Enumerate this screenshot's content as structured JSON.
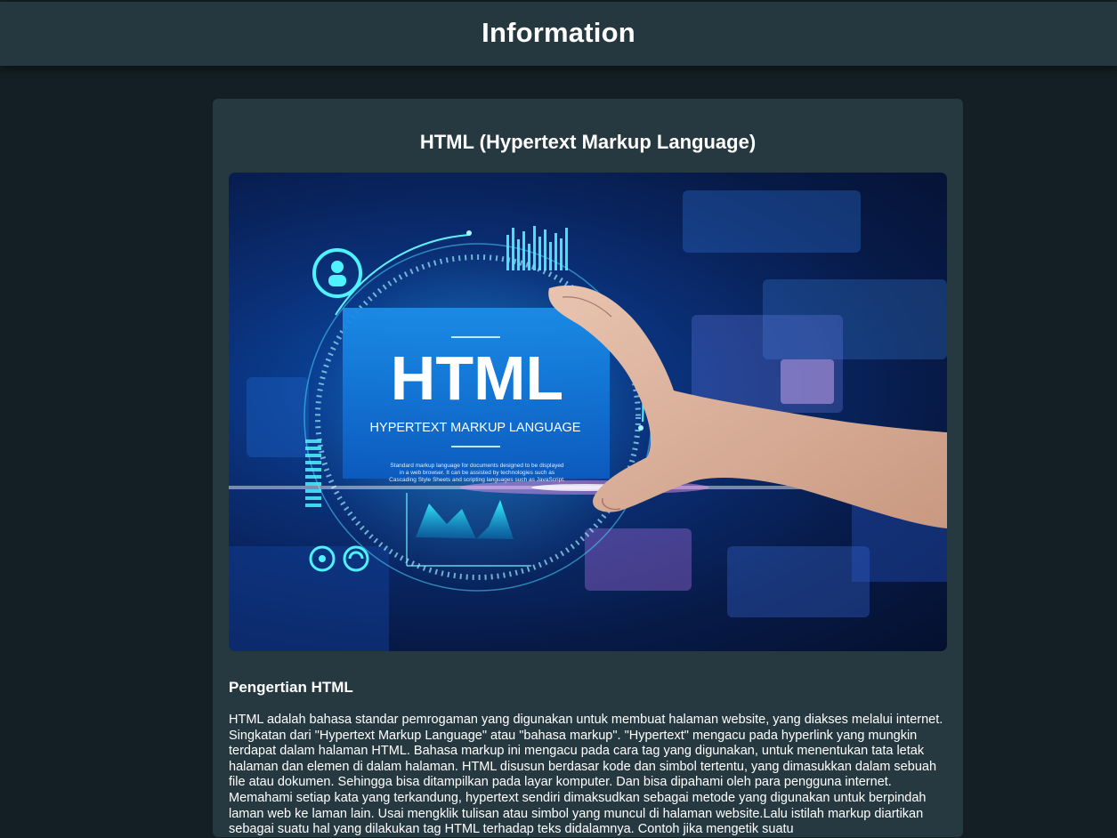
{
  "header": {
    "title": "Information"
  },
  "card": {
    "title": "HTML (Hypertext Markup Language)",
    "image": {
      "headline": "HTML",
      "subheadline": "HYPERTEXT MARKUP LANGUAGE",
      "caption_line1": "Standard markup language for documents designed to be displayed",
      "caption_line2": "in a web browser. It can be assisted by technologies such as",
      "caption_line3": "Cascading Style Sheets and scripting languages such as JavaScript."
    },
    "section_heading": "Pengertian HTML",
    "body": "HTML adalah bahasa standar pemrogaman yang digunakan untuk membuat halaman website, yang diakses melalui internet. Singkatan dari \"Hypertext Markup Language\" atau \"bahasa markup\". \"Hypertext\" mengacu pada hyperlink yang mungkin terdapat dalam halaman HTML. Bahasa markup ini mengacu pada cara tag yang digunakan, untuk menentukan tata letak halaman dan elemen di dalam halaman. HTML disusun berdasar kode dan simbol tertentu, yang dimasukkan dalam sebuah file atau dokumen. Sehingga bisa ditampilkan pada layar komputer. Dan bisa dipahami oleh para pengguna internet. Memahami setiap kata yang terkandung, hypertext sendiri dimaksudkan sebagai metode yang digunakan untuk berpindah laman web ke laman lain. Usai mengklik tulisan atau simbol yang muncul di halaman website.Lalu istilah markup diartikan sebagai suatu hal yang dilakukan tag HTML terhadap teks didalamnya. Contoh jika mengetik suatu"
  }
}
